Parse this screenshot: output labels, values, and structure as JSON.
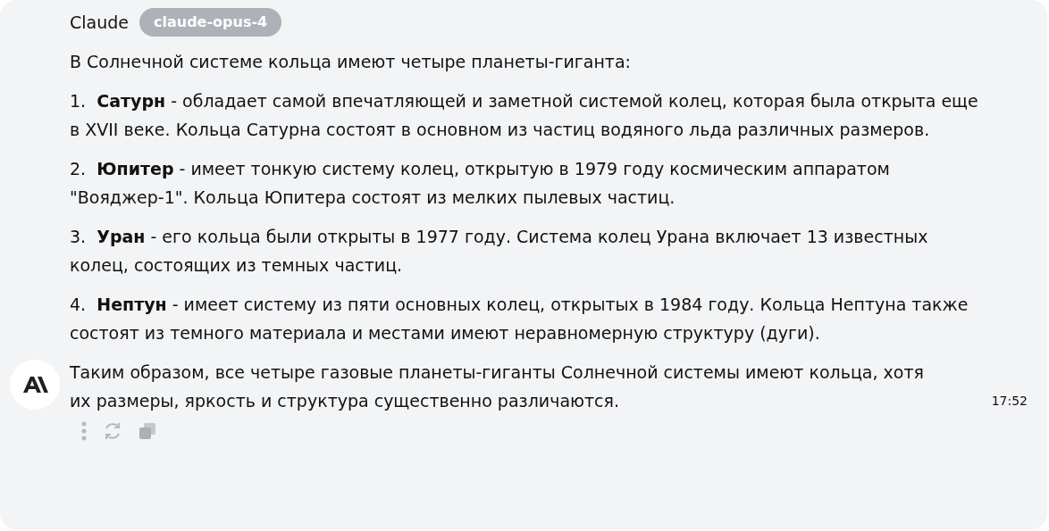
{
  "message": {
    "author": "Claude",
    "model_badge": "claude-opus-4",
    "intro": "В Солнечной системе кольца имеют четыре планеты-гиганта:",
    "items": [
      {
        "number": "1.",
        "term": "Сатурн",
        "text": " - обладает самой впечатляющей и заметной системой колец, которая была открыта еще в XVII веке. Кольца Сатурна состоят в основном из частиц водяного льда различных размеров."
      },
      {
        "number": "2.",
        "term": "Юпитер",
        "text": " - имеет тонкую систему колец, открытую в 1979 году космическим аппаратом \"Вояджер-1\". Кольца Юпитера состоят из мелких пылевых частиц."
      },
      {
        "number": "3.",
        "term": "Уран",
        "text": " - его кольца были открыты в 1977 году. Система колец Урана включает 13 известных колец, состоящих из темных частиц."
      },
      {
        "number": "4.",
        "term": "Нептун",
        "text": " - имеет систему из пяти основных колец, открытых в 1984 году. Кольца Нептуна также состоят из темного материала и местами имеют неравномерную структуру (дуги)."
      }
    ],
    "conclusion": "Таким образом, все четыре газовые планеты-гиганты Солнечной системы имеют кольца, хотя их размеры, яркость и структура существенно различаются.",
    "time": "17:52"
  }
}
